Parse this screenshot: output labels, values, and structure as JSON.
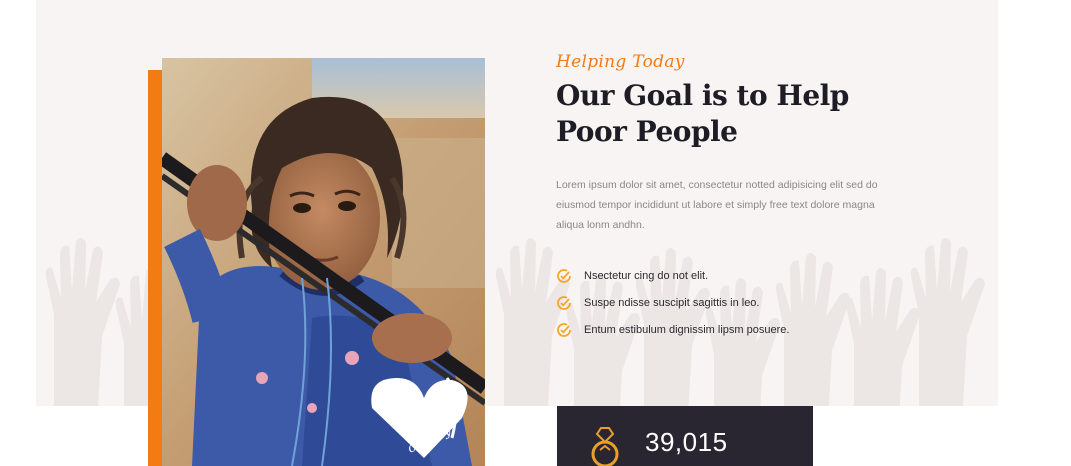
{
  "about": {
    "subtitle": "Helping Today",
    "title": "Our Goal is to Help Poor People",
    "paragraph": "Lorem ipsum dolor sit amet, consectetur notted adipisicing elit sed do eiusmod tempor incididunt ut labore et simply free text dolore magna aliqua lonm andhn.",
    "features": [
      {
        "icon": "check-circle-icon",
        "text": "Nsectetur cing do not elit."
      },
      {
        "icon": "check-circle-icon",
        "text": "Suspe ndisse suscipit sagittis in leo."
      },
      {
        "icon": "check-circle-icon",
        "text": "Entum estibulum dignissim lipsm posuere."
      }
    ]
  },
  "stat": {
    "icon": "ring-icon",
    "value": "39,015"
  },
  "photo": {
    "shirt_text": "charity"
  },
  "colors": {
    "accent": "#f47a12",
    "heading": "#1e1c24",
    "body_text": "#8b8787",
    "section_bg": "#f8f4f3",
    "stat_bg": "#2a2631",
    "check": "#f5a623"
  }
}
